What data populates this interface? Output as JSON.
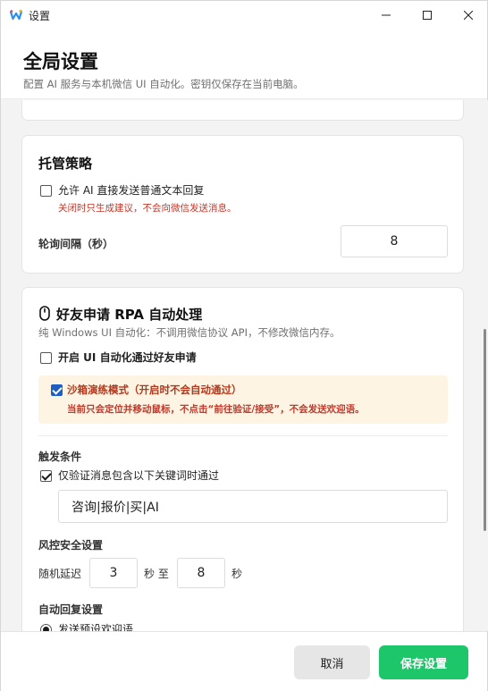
{
  "window": {
    "title": "设置",
    "controls": {
      "minimize": "minimize-icon",
      "maximize": "maximize-icon",
      "close": "close-icon"
    }
  },
  "header": {
    "title": "全局设置",
    "subtitle": "配置 AI 服务与本机微信 UI 自动化。密钥仅保存在当前电脑。"
  },
  "hosting": {
    "title": "托管策略",
    "allow_direct_reply": {
      "label": "允许 AI 直接发送普通文本回复",
      "checked": false
    },
    "allow_direct_reply_hint": "关闭时只生成建议，不会向微信发送消息。",
    "poll_interval_label": "轮询间隔（秒）",
    "poll_interval_value": "8"
  },
  "friend": {
    "title": "好友申请 RPA 自动处理",
    "icon": "mouse-icon",
    "description": "纯 Windows UI 自动化：不调用微信协议 API，不修改微信内存。",
    "enable": {
      "label": "开启 UI 自动化通过好友申请",
      "checked": false
    },
    "sandbox": {
      "label": "沙箱演练模式（开启时不会自动通过）",
      "checked": true,
      "description": "当前只会定位并移动鼠标，不点击“前往验证/接受”，不会发送欢迎语。"
    },
    "trigger": {
      "title": "触发条件",
      "keyword_only": {
        "label": "仅验证消息包含以下关键词时通过",
        "checked": true
      },
      "keywords": "咨询|报价|买|AI"
    },
    "risk": {
      "title": "风控安全设置",
      "delay_label": "随机延迟",
      "delay_min": "3",
      "seconds_to": "秒 至",
      "delay_max": "8",
      "seconds": "秒"
    },
    "auto_reply": {
      "title": "自动回复设置",
      "option_preset": "发送预设欢迎语"
    }
  },
  "footer": {
    "cancel_label": "取消",
    "save_label": "保存设置"
  },
  "colors": {
    "accent_green": "#1ec66a",
    "warning_red": "#c0392b",
    "sandbox_bg": "#fdf4e3",
    "checkbox_blue": "#1f5fbf"
  }
}
